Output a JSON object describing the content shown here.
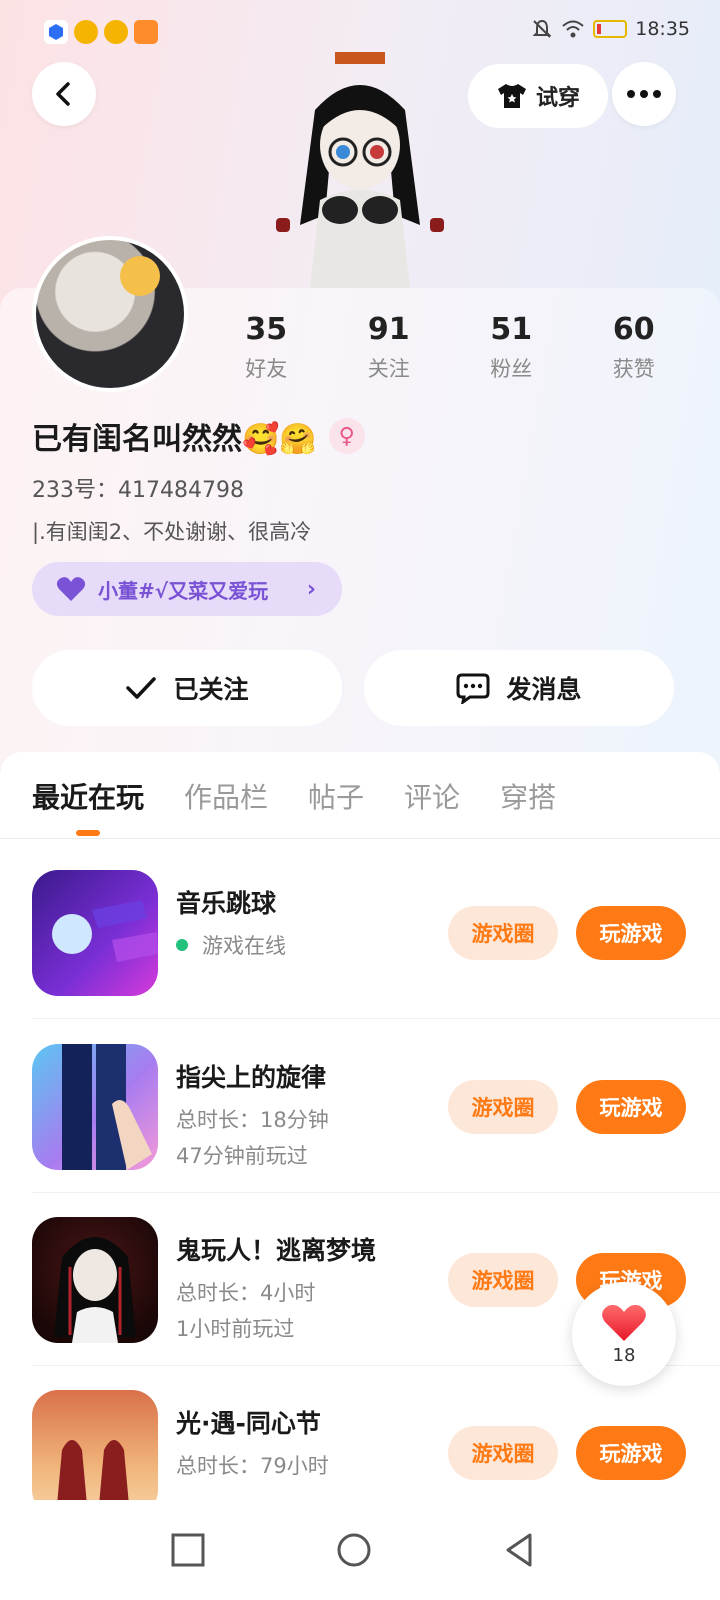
{
  "status_bar": {
    "time": "18:35",
    "icons": [
      "security-app-icon",
      "taobao-app-icon",
      "taobao-app-icon",
      "shopping-app-icon",
      "mute-icon",
      "wifi-icon",
      "battery-icon"
    ]
  },
  "header": {
    "back_icon": "back-arrow-icon",
    "tryon_label": "试穿",
    "more_icon": "more-dots-icon"
  },
  "profile": {
    "stats": [
      {
        "value": "35",
        "label": "好友"
      },
      {
        "value": "91",
        "label": "关注"
      },
      {
        "value": "51",
        "label": "粉丝"
      },
      {
        "value": "60",
        "label": "获赞"
      }
    ],
    "name": "已有闺名叫然然🥰🤗",
    "gender_symbol": "♀",
    "uid": "233号：417484798",
    "bio": "|.有闺闺2、不处谢谢、很高冷",
    "guild": "小董#√又菜又爱玩",
    "follow_label": "已关注",
    "message_label": "发消息"
  },
  "tabs": [
    "最近在玩",
    "作品栏",
    "帖子",
    "评论",
    "穿搭"
  ],
  "games": [
    {
      "title": "音乐跳球",
      "line1": "游戏在线",
      "line2": "",
      "online": true,
      "circle_label": "游戏圈",
      "play_label": "玩游戏"
    },
    {
      "title": "指尖上的旋律",
      "line1": "总时长：18分钟",
      "line2": "47分钟前玩过",
      "online": false,
      "circle_label": "游戏圈",
      "play_label": "玩游戏"
    },
    {
      "title": "鬼玩人！逃离梦境",
      "line1": "总时长：4小时",
      "line2": "1小时前玩过",
      "online": false,
      "circle_label": "游戏圈",
      "play_label": "玩游戏"
    },
    {
      "title": "光·遇-同心节",
      "line1": "总时长：79小时",
      "line2": "",
      "online": false,
      "circle_label": "游戏圈",
      "play_label": "玩游戏"
    }
  ],
  "like_fab": {
    "count": "18"
  },
  "colors": {
    "accent": "#ff7a14",
    "online": "#22b573",
    "guild": "#7a52d6"
  }
}
